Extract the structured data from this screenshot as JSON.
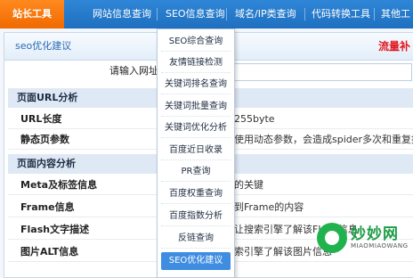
{
  "topnav": {
    "items": [
      "站长工具",
      "网站信息查询",
      "SEO信息查询",
      "域名/IP类查询",
      "代码转换工具",
      "其他工"
    ]
  },
  "panel": {
    "title": "seo优化建议",
    "right_text": "流量补",
    "url_label": "请输入网址"
  },
  "sections": [
    {
      "title": "页面URL分析",
      "rows": [
        {
          "key": "URL长度",
          "value": "255byte"
        },
        {
          "key": "静态页参数",
          "value": "使用动态参数，会造成spider多次和重复抓取"
        }
      ]
    },
    {
      "title": "页面内容分析",
      "rows": [
        {
          "key": "Meta及标签信息",
          "value": "的关键"
        },
        {
          "key": "Frame信息",
          "value": "到Frame的内容"
        },
        {
          "key": "Flash文字描述",
          "value": "让搜索引擎了解该Flash信息"
        },
        {
          "key": "图片ALT信息",
          "value": "索引擎了解该图片信息"
        }
      ]
    }
  ],
  "dropdown": {
    "items": [
      "SEO综合查询",
      "友情链接检测",
      "关键词排名查询",
      "关键词批量查询",
      "关键词优化分析",
      "百度近日收录",
      "PR查询",
      "百度权重查询",
      "百度指数分析",
      "反链查询",
      "SEO优化建议"
    ],
    "selected_index": 10
  },
  "watermark": {
    "title": "妙妙网",
    "subtitle": "MIAOMIAOWANG"
  },
  "colors": {
    "nav_blue": "#1f6fc0",
    "nav_active": "#f06a00",
    "dropdown_selected": "#3f8de0"
  }
}
